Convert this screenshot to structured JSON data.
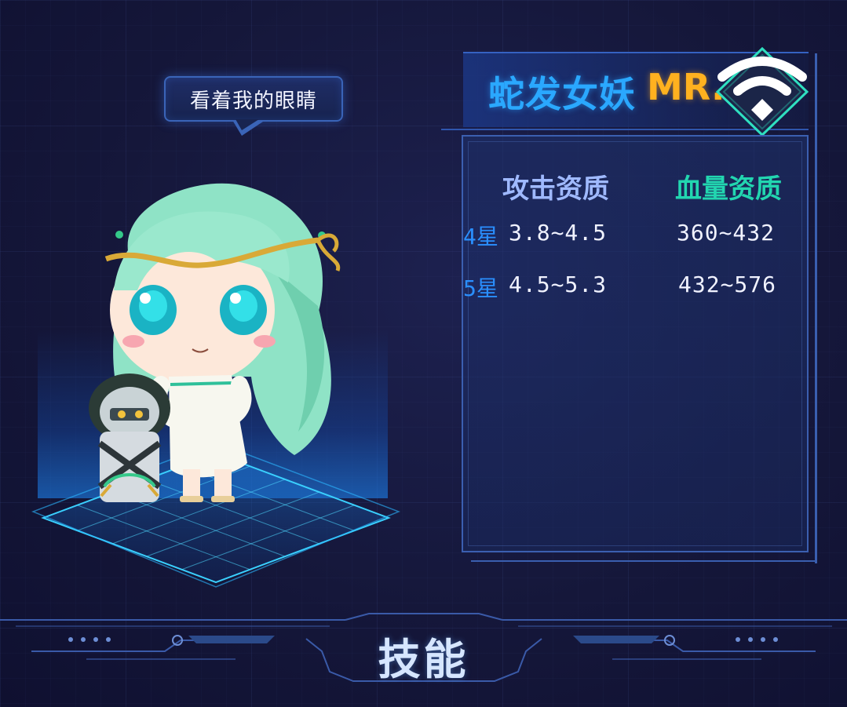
{
  "speech_bubble": {
    "text": "看着我的眼睛"
  },
  "hero": {
    "name": "蛇发女妖",
    "grade": "MR."
  },
  "stats": {
    "headers": {
      "attack": "攻击资质",
      "hp": "血量资质"
    },
    "rows": [
      {
        "star": "4星",
        "attack": "3.8~4.5",
        "hp": "360~432"
      },
      {
        "star": "5星",
        "attack": "4.5~5.3",
        "hp": "432~576"
      }
    ]
  },
  "footer": {
    "title": "技能"
  },
  "colors": {
    "name_blue": "#2aa8ff",
    "grade_gold": "#ffb11f",
    "hp_header_teal": "#22d6b0",
    "attack_header": "#9fb9ff",
    "star_blue": "#2a8fff"
  },
  "icons": [
    "wifi-icon"
  ]
}
